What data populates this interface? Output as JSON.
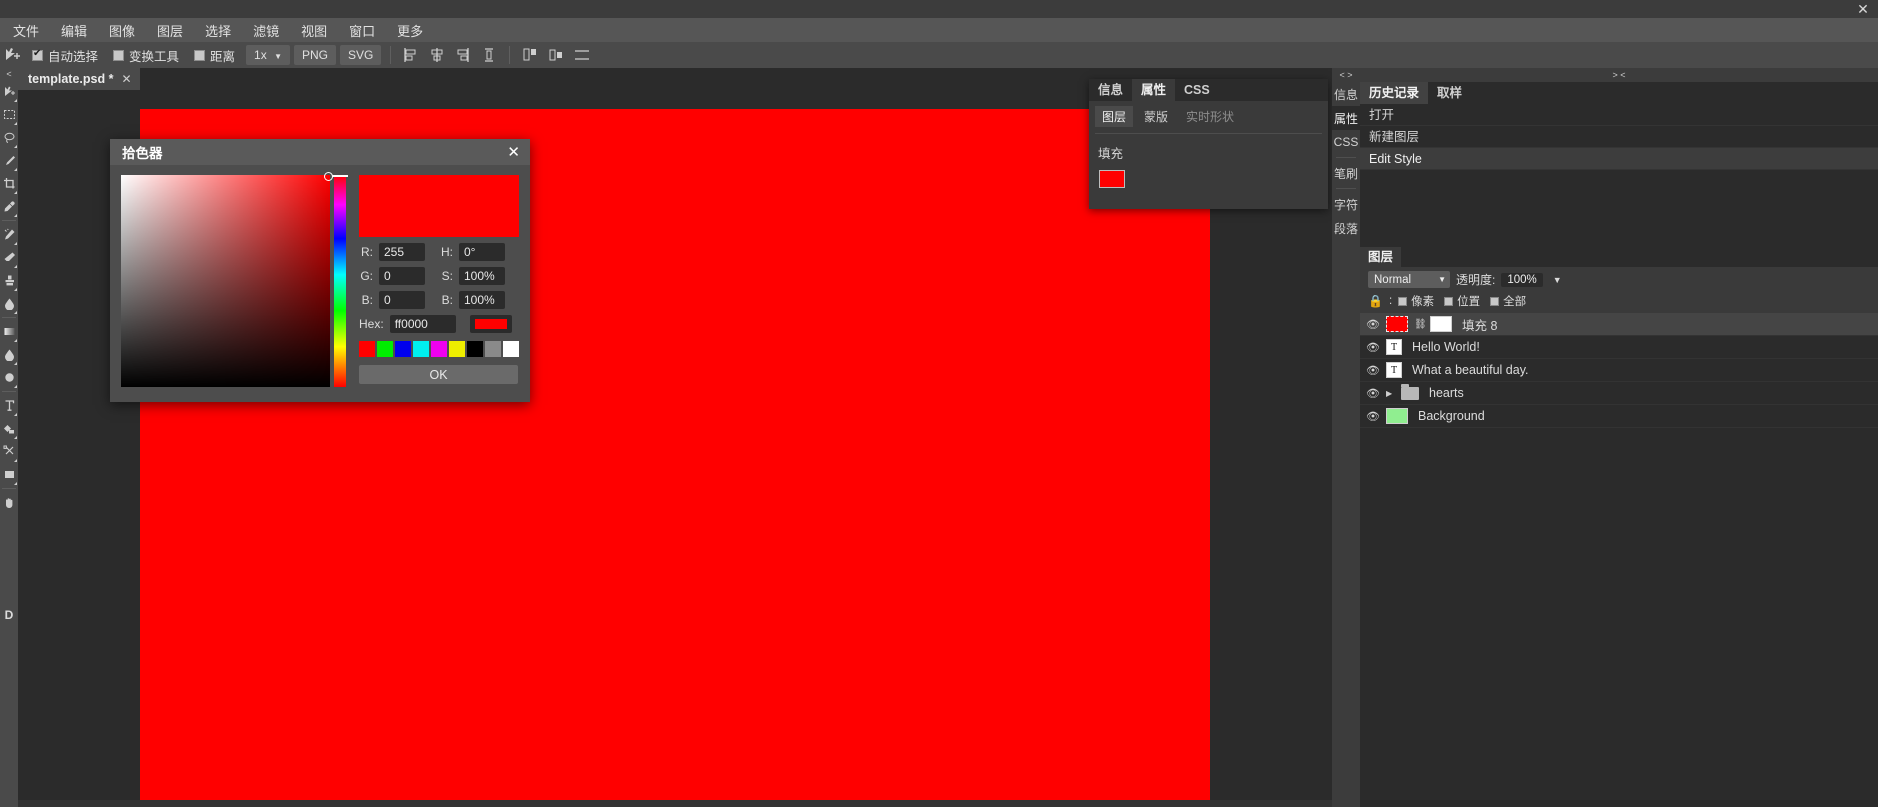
{
  "app": {
    "window_close": "✕"
  },
  "menubar": {
    "items": [
      {
        "label": "文件",
        "name": "menu-file"
      },
      {
        "label": "编辑",
        "name": "menu-edit"
      },
      {
        "label": "图像",
        "name": "menu-image"
      },
      {
        "label": "图层",
        "name": "menu-layer"
      },
      {
        "label": "选择",
        "name": "menu-select"
      },
      {
        "label": "滤镜",
        "name": "menu-filter"
      },
      {
        "label": "视图",
        "name": "menu-view"
      },
      {
        "label": "窗口",
        "name": "menu-window"
      },
      {
        "label": "更多",
        "name": "menu-more"
      }
    ]
  },
  "options_bar": {
    "auto_select": {
      "label": "自动选择",
      "checked": true
    },
    "transform_tool": {
      "label": "变换工具",
      "checked": false
    },
    "distance": {
      "label": "距离",
      "checked": false
    },
    "zoom_select": "1x",
    "png_button": "PNG",
    "svg_button": "SVG"
  },
  "document_tab": {
    "title": "template.psd *",
    "close": "✕"
  },
  "canvas": {
    "fill_color": "#ff0000"
  },
  "picker": {
    "title": "拾色器",
    "close": "✕",
    "preview_color": "#ff0000",
    "rgb": [
      {
        "label": "R:",
        "value": "255"
      },
      {
        "label": "G:",
        "value": "0"
      },
      {
        "label": "B:",
        "value": "0"
      }
    ],
    "hsb": [
      {
        "label": "H:",
        "value": "0°"
      },
      {
        "label": "S:",
        "value": "100%"
      },
      {
        "label": "B:",
        "value": "100%"
      }
    ],
    "hex_label": "Hex:",
    "hex_value": "ff0000",
    "hex_chip_color": "#ff0000",
    "swatches": [
      "#ff0000",
      "#00ee00",
      "#0000ee",
      "#00eeee",
      "#ee00ee",
      "#eeee00",
      "#000000",
      "#8a8a8a",
      "#ffffff"
    ],
    "ok_label": "OK"
  },
  "properties_panel": {
    "tabs": [
      {
        "label": "信息",
        "active": false
      },
      {
        "label": "属性",
        "active": true
      },
      {
        "label": "CSS",
        "active": false
      }
    ],
    "subtabs": [
      {
        "label": "图层",
        "active": true,
        "dim": false
      },
      {
        "label": "蒙版",
        "active": false,
        "dim": false
      },
      {
        "label": "实时形状",
        "active": false,
        "dim": true
      }
    ],
    "fill_label": "填充",
    "fill_color": "#ff0000"
  },
  "rail": {
    "top_glyph": "< >",
    "items": [
      {
        "label": "信息",
        "active": false
      },
      {
        "label": "属性",
        "active": true
      },
      {
        "label": "CSS",
        "active": false
      },
      {
        "label": "笔刷",
        "active": false
      },
      {
        "label": "字符",
        "active": false
      },
      {
        "label": "段落",
        "active": false
      }
    ]
  },
  "right_column": {
    "header_glyph": "> <",
    "history": {
      "tabs": [
        {
          "label": "历史记录",
          "active": true
        },
        {
          "label": "取样",
          "active": false
        }
      ],
      "items": [
        {
          "label": "打开",
          "selected": false
        },
        {
          "label": "新建图层",
          "selected": false
        },
        {
          "label": "Edit Style",
          "selected": true
        }
      ]
    },
    "layers": {
      "tab_label": "图层",
      "blend_mode": "Normal",
      "opacity_label": "透明度:",
      "opacity_value": "100%",
      "lock_label": ":",
      "lock_options": [
        {
          "label": "像素"
        },
        {
          "label": "位置"
        },
        {
          "label": "全部"
        }
      ],
      "rows": [
        {
          "name": "填充 8",
          "type": "shape",
          "thumb": "#ff0000",
          "selected": true,
          "has_mask": true
        },
        {
          "name": "Hello World!",
          "type": "text",
          "thumb_glyph": "T",
          "selected": false
        },
        {
          "name": "What a beautiful day.",
          "type": "text",
          "thumb_glyph": "T",
          "selected": false
        },
        {
          "name": "hearts",
          "type": "group",
          "selected": false
        },
        {
          "name": "Background",
          "type": "raster",
          "thumb": "#90ee90",
          "selected": false
        }
      ]
    }
  },
  "toolbar": {
    "collapse_glyph": "<",
    "foreground_glyph": "D",
    "tools": [
      {
        "name": "move-tool",
        "selected": false
      },
      {
        "name": "marquee-tool",
        "selected": false
      },
      {
        "name": "lasso-tool",
        "selected": false
      },
      {
        "name": "brush-tool",
        "selected": false
      },
      {
        "name": "crop-tool",
        "selected": false
      },
      {
        "name": "eyedropper-tool",
        "selected": false
      },
      {
        "name": "healing-tool",
        "selected": false
      },
      {
        "name": "eraser-tool",
        "selected": false
      },
      {
        "name": "stamp-tool",
        "selected": false
      },
      {
        "name": "blur-tool",
        "selected": false
      },
      {
        "name": "gradient-tool",
        "selected": false
      },
      {
        "name": "dodge-tool",
        "selected": false
      },
      {
        "name": "ellipse-tool",
        "selected": false
      },
      {
        "name": "type-tool",
        "selected": false
      },
      {
        "name": "shape-tool",
        "selected": false
      },
      {
        "name": "pen-tool",
        "selected": false
      },
      {
        "name": "rectangle-tool",
        "selected": false
      },
      {
        "name": "hand-tool",
        "selected": false
      }
    ]
  }
}
